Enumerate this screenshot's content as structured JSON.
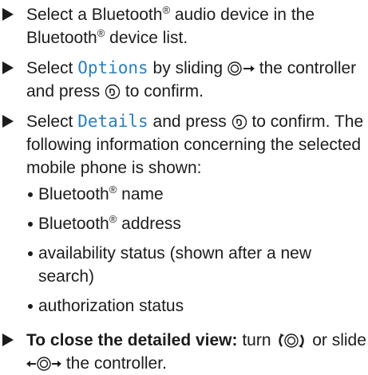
{
  "steps": [
    {
      "text_before": "Select a Bluetooth",
      "reg": "®",
      "text_after": " audio device in the Bluetooth",
      "reg2": "®",
      "text_end": " device list."
    },
    {
      "text_before": "Select ",
      "highlight": "Options",
      "text_mid": " by sliding ",
      "text_after": " the controller and press ",
      "text_end": " to confirm."
    },
    {
      "text_before": "Select ",
      "highlight": "Details",
      "text_mid": " and press ",
      "text_after": " to confirm. The following information concerning the selected mobile phone is shown:",
      "bullets": [
        {
          "text": "Bluetooth",
          "reg": "®",
          "suffix": " name"
        },
        {
          "text": "Bluetooth",
          "reg": "®",
          "suffix": " address"
        },
        {
          "text": "availability status (shown after a new search)"
        },
        {
          "text": "authorization status"
        }
      ]
    },
    {
      "bold_lead": "To close the detailed view:",
      "text_mid": " turn ",
      "text_or": " or slide ",
      "text_end": " the controller."
    }
  ],
  "icons": {
    "slide_right": "controller-slide-right-icon",
    "press": "controller-press-icon",
    "turn": "controller-turn-icon",
    "slide_left_right": "controller-slide-left-right-icon"
  },
  "colors": {
    "text": "#1c1c1c",
    "highlight": "#2a7fc0"
  }
}
